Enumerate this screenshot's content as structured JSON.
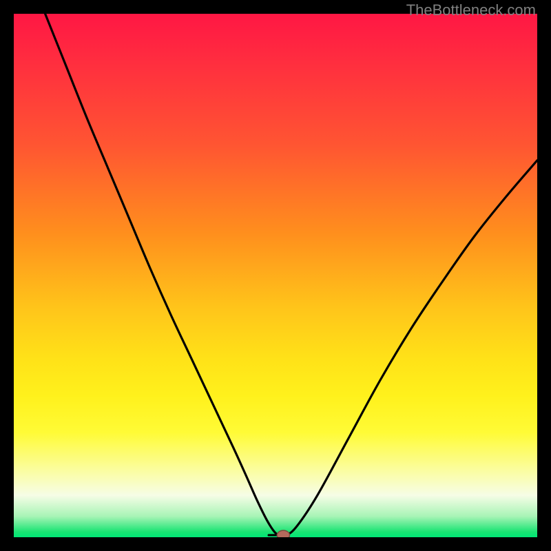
{
  "attribution": "TheBottleneck.com",
  "colors": {
    "frame": "#000000",
    "curve": "#000000",
    "marker_fill": "#b56a5d",
    "marker_stroke": "#7a4a3d",
    "gradient_top": "#ff1744",
    "gradient_mid": "#fff11c",
    "gradient_bottom": "#00e676"
  },
  "chart_data": {
    "type": "line",
    "title": "",
    "xlabel": "",
    "ylabel": "",
    "xlim": [
      0,
      100
    ],
    "ylim": [
      0,
      100
    ],
    "grid": false,
    "legend": false,
    "series": [
      {
        "name": "bottleneck-curve",
        "x": [
          6,
          10,
          14,
          18,
          22,
          26,
          30,
          34,
          38,
          42,
          44.5,
          46.5,
          48.5,
          50,
          51,
          52,
          54,
          58,
          64,
          70,
          76,
          82,
          88,
          94,
          100
        ],
        "y": [
          100,
          90,
          80,
          70.5,
          61,
          51.5,
          42.5,
          34,
          25.5,
          17,
          11.5,
          7,
          3,
          0.8,
          0.4,
          0.4,
          2,
          8,
          19,
          30,
          40,
          49,
          57.5,
          65,
          72
        ]
      }
    ],
    "marker": {
      "x": 51.5,
      "y": 0.4,
      "rx": 1.2,
      "ry": 0.9
    },
    "flat_segment": {
      "x0": 48.7,
      "x1": 51.2,
      "y": 0.4
    }
  }
}
